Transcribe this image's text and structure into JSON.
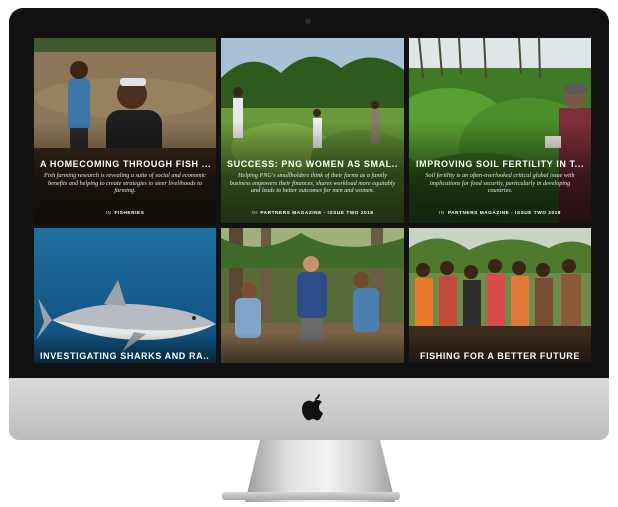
{
  "device": {
    "logo_icon": "apple-logo-icon"
  },
  "articles": [
    {
      "title": "A HOMECOMING THROUGH FISH ...",
      "excerpt": "Fish farming research is revealing a suite of social and economic benefits and helping to create strategies to steer livelihoods to farming.",
      "prefix": "IN",
      "category": "FISHERIES"
    },
    {
      "title": "SUCCESS: PNG WOMEN AS SMAL...",
      "excerpt": "Helping PNG's smallholders think of their farms as a family business empowers their finances, shares workload more equitably and leads to better outcomes for men and women.",
      "prefix": "IN",
      "category": "PARTNERS MAGAZINE - ISSUE TWO 2018"
    },
    {
      "title": "IMPROVING SOIL FERTILITY IN T...",
      "excerpt": "Soil fertility is an often-overlooked critical global issue with implications for food security, particularly in developing countries.",
      "prefix": "IN",
      "category": "PARTNERS MAGAZINE - ISSUE TWO 2018"
    },
    {
      "title": "INVESTIGATING SHARKS AND RA..."
    },
    {
      "title": ""
    },
    {
      "title": "FISHING FOR A BETTER FUTURE"
    }
  ]
}
